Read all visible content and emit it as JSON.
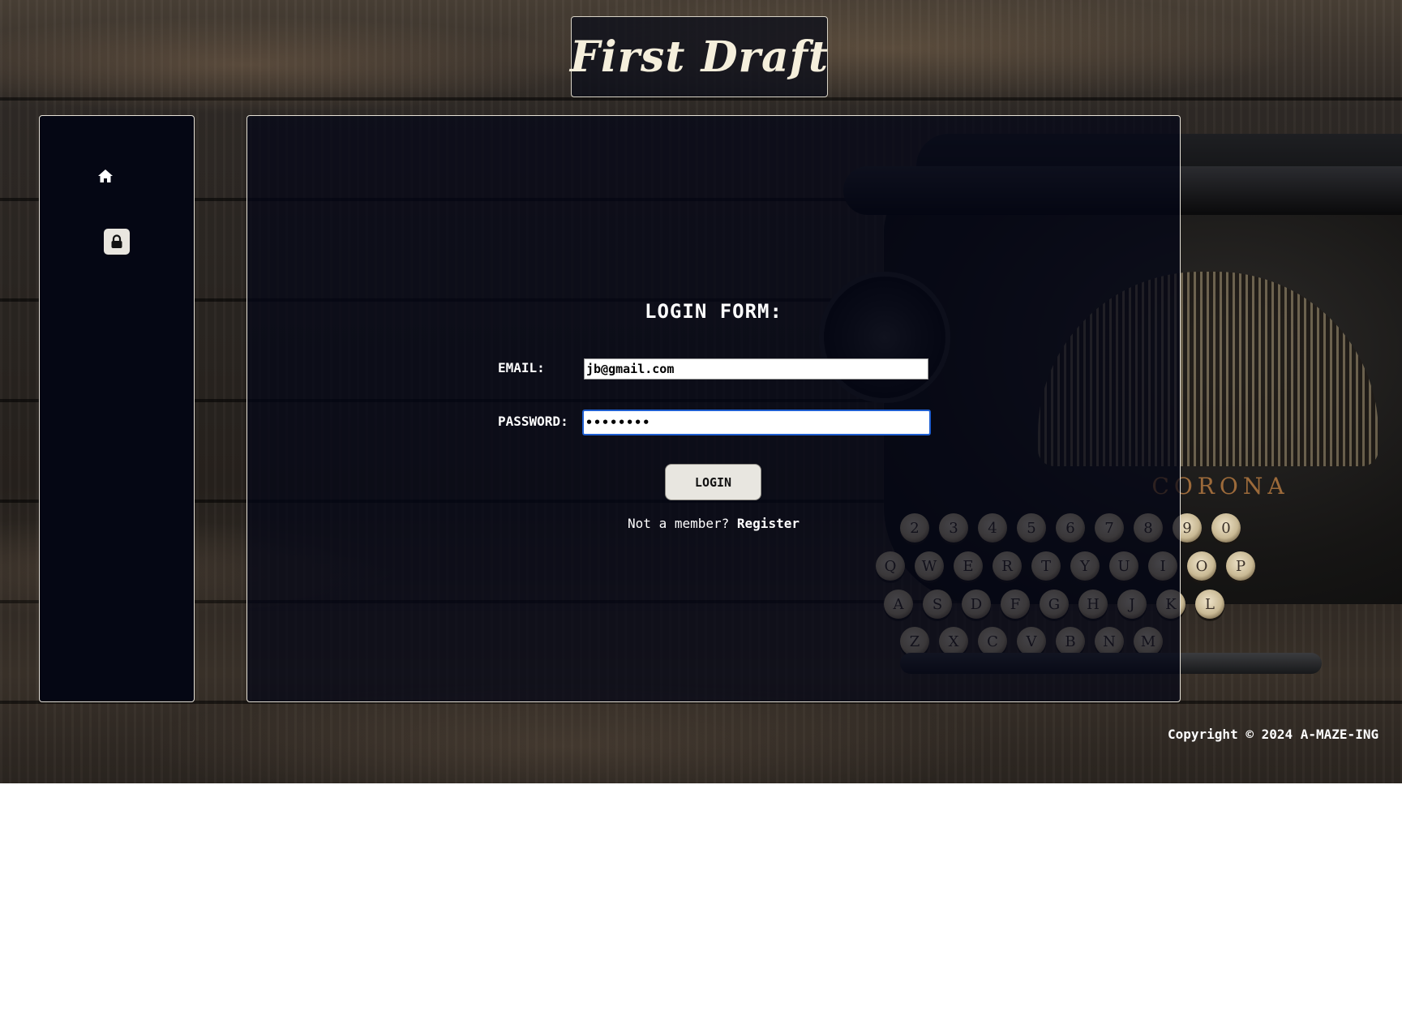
{
  "header": {
    "logo_text": "First Draft"
  },
  "sidebar": {
    "items": [
      {
        "icon": "home-icon"
      },
      {
        "icon": "lock-icon"
      }
    ]
  },
  "login_form": {
    "title": "LOGIN FORM:",
    "email_label": "EMAIL:",
    "email_value": "jb@gmail.com",
    "password_label": "PASSWORD:",
    "password_value": "••••••••",
    "login_button": "LOGIN",
    "member_prompt": "Not a member?",
    "register_link": "Register"
  },
  "footer": {
    "copyright": "Copyright © 2024 A-MAZE-ING"
  },
  "background": {
    "typewriter_brand": "CORONA",
    "keys": [
      "2",
      "3",
      "4",
      "5",
      "6",
      "7",
      "8",
      "9",
      "0",
      "Q",
      "W",
      "E",
      "R",
      "T",
      "Y",
      "U",
      "I",
      "O",
      "P",
      "A",
      "S",
      "D",
      "F",
      "G",
      "H",
      "J",
      "K",
      "L",
      "Z",
      "X",
      "C",
      "V",
      "B",
      "N",
      "M"
    ]
  },
  "colors": {
    "panel_bg": "#050714",
    "panel_border": "#e6e1d6",
    "focus_ring": "#1f5fd1",
    "button_bg": "#e8e6e0"
  }
}
